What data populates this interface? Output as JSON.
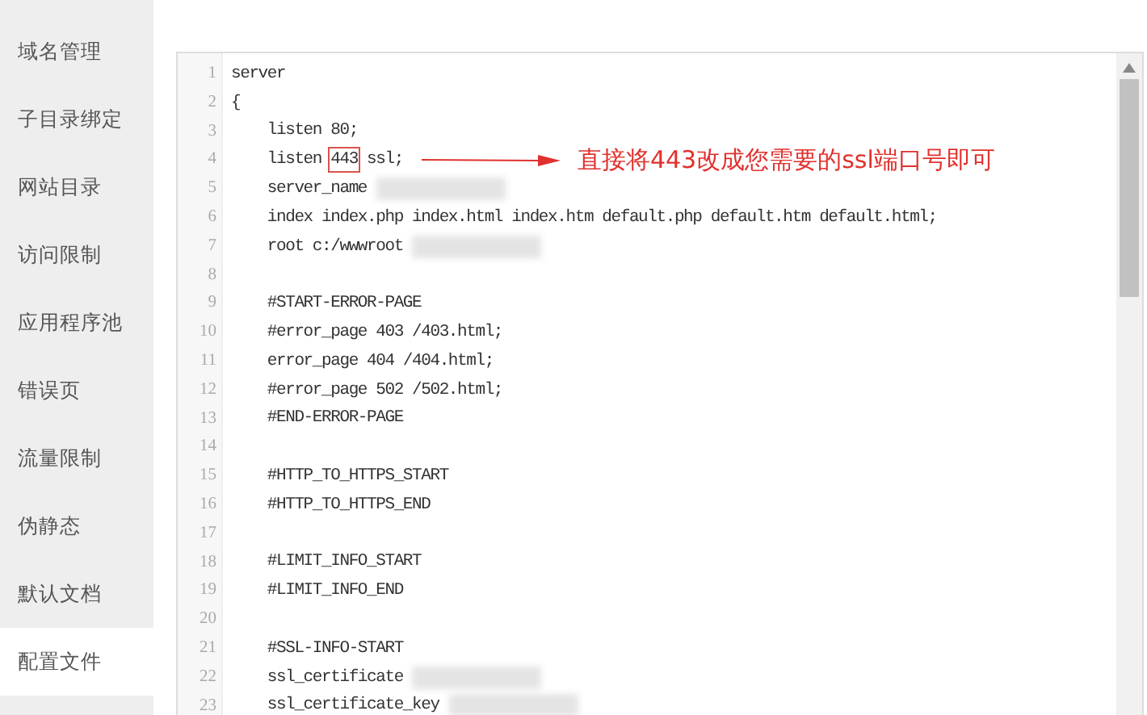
{
  "sidebar": {
    "items": [
      {
        "label": "域名管理",
        "selected": false
      },
      {
        "label": "子目录绑定",
        "selected": false
      },
      {
        "label": "网站目录",
        "selected": false
      },
      {
        "label": "访问限制",
        "selected": false
      },
      {
        "label": "应用程序池",
        "selected": false
      },
      {
        "label": "错误页",
        "selected": false
      },
      {
        "label": "流量限制",
        "selected": false
      },
      {
        "label": "伪静态",
        "selected": false
      },
      {
        "label": "默认文档",
        "selected": false
      },
      {
        "label": "配置文件",
        "selected": true
      }
    ]
  },
  "editor": {
    "lines": [
      {
        "no": "1",
        "parts": [
          {
            "text": "server"
          }
        ]
      },
      {
        "no": "2",
        "parts": [
          {
            "text": "{"
          }
        ]
      },
      {
        "no": "3",
        "parts": [
          {
            "text": "    listen 80;"
          }
        ]
      },
      {
        "no": "4",
        "parts": [
          {
            "text": "    listen "
          },
          {
            "text": "443",
            "boxed": true
          },
          {
            "text": " ssl;"
          }
        ],
        "note": "直接将443改成您需要的ssl端口号即可"
      },
      {
        "no": "5",
        "parts": [
          {
            "text": "    server_name"
          }
        ],
        "redacted": true
      },
      {
        "no": "6",
        "parts": [
          {
            "text": "    index index.php index.html index.htm default.php default.htm default.html;"
          }
        ]
      },
      {
        "no": "7",
        "parts": [
          {
            "text": "    root c:/wwwroot"
          }
        ],
        "redacted": true
      },
      {
        "no": "8"
      },
      {
        "no": "9",
        "parts": [
          {
            "text": "    #START-ERROR-PAGE"
          }
        ]
      },
      {
        "no": "10",
        "parts": [
          {
            "text": "    #error_page 403 /403.html;"
          }
        ]
      },
      {
        "no": "11",
        "parts": [
          {
            "text": "    error_page 404 /404.html;"
          }
        ]
      },
      {
        "no": "12",
        "parts": [
          {
            "text": "    #error_page 502 /502.html;"
          }
        ]
      },
      {
        "no": "13",
        "parts": [
          {
            "text": "    #END-ERROR-PAGE"
          }
        ]
      },
      {
        "no": "14"
      },
      {
        "no": "15",
        "parts": [
          {
            "text": "    #HTTP_TO_HTTPS_START"
          }
        ]
      },
      {
        "no": "16",
        "parts": [
          {
            "text": "    #HTTP_TO_HTTPS_END"
          }
        ]
      },
      {
        "no": "17"
      },
      {
        "no": "18",
        "parts": [
          {
            "text": "    #LIMIT_INFO_START"
          }
        ]
      },
      {
        "no": "19",
        "parts": [
          {
            "text": "    #LIMIT_INFO_END"
          }
        ]
      },
      {
        "no": "20"
      },
      {
        "no": "21",
        "parts": [
          {
            "text": "    #SSL-INFO-START"
          }
        ]
      },
      {
        "no": "22",
        "parts": [
          {
            "text": "    ssl_certificate"
          }
        ],
        "redacted": true
      },
      {
        "no": "23",
        "parts": [
          {
            "text": "    ssl_certificate_key"
          }
        ],
        "redacted": true
      }
    ]
  }
}
